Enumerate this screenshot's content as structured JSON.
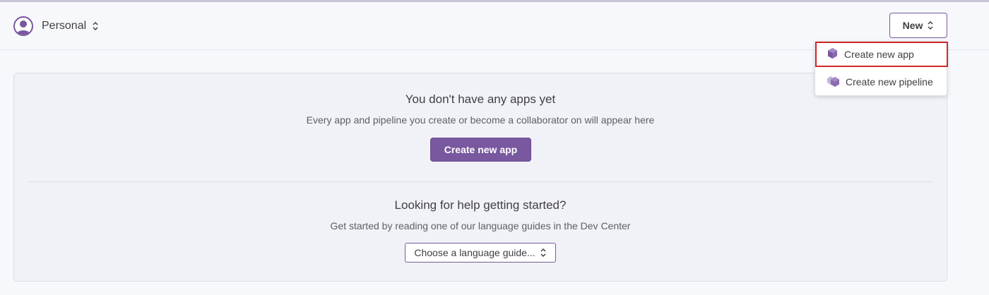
{
  "header": {
    "account_label": "Personal",
    "account_icon": "user-avatar-icon",
    "new_button_label": "New"
  },
  "dropdown": {
    "items": [
      {
        "label": "Create new app",
        "icon": "app-cube-icon",
        "highlighted": true
      },
      {
        "label": "Create new pipeline",
        "icon": "pipeline-cubes-icon",
        "highlighted": false
      }
    ]
  },
  "empty_state": {
    "title": "You don't have any apps yet",
    "subtitle": "Every app and pipeline you create or become a collaborator on will appear here",
    "button_label": "Create new app"
  },
  "help": {
    "title": "Looking for help getting started?",
    "subtitle": "Get started by reading one of our language guides in the Dev Center",
    "select_label": "Choose a language guide..."
  },
  "colors": {
    "accent": "#79589f",
    "highlight_outline": "#d02a2a",
    "background": "#f7f8fb",
    "card_background": "#f1f2f7"
  }
}
